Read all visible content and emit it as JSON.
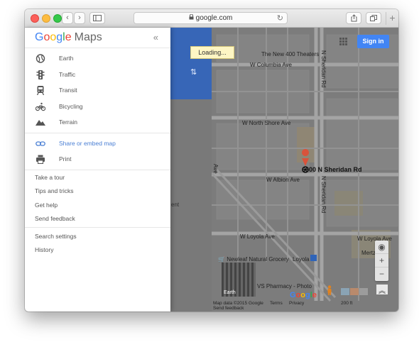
{
  "browser": {
    "url": "google.com",
    "new_tab": "+"
  },
  "map": {
    "loading_text": "Loading...",
    "sign_in": "Sign in",
    "address": "6600 N Sheridan Rd",
    "streets": {
      "columbia": "W Columbia Ave",
      "north_shore": "W North Shore Ave",
      "albion": "W Albion Ave",
      "loyola": "W Loyola Ave",
      "loyola2": "W Loyola Ave",
      "sheridan1": "N Sheridan Rd",
      "sheridan2": "N Sheridan Rd",
      "ave_fragment": "Ave"
    },
    "pois": {
      "theaters": "The New 400 Theaters",
      "grocery": "Newleaf Natural Grocery",
      "loyola_station": "Loyola",
      "pharmacy": "VS Pharmacy - Photo",
      "mertz": "Mertz"
    },
    "earth_label": "Earth",
    "google_logo": "Google",
    "attribution": {
      "data": "Map data ©2015 Google",
      "terms": "Terms",
      "privacy": "Privacy",
      "feedback": "Send feedback",
      "scale": "200 ft"
    },
    "panel_fragment": "ent"
  },
  "menu": {
    "logo_google": [
      "G",
      "o",
      "o",
      "g",
      "l",
      "e"
    ],
    "logo_maps": "Maps",
    "collapse": "«",
    "layers": [
      {
        "label": "Earth",
        "icon": "globe-icon"
      },
      {
        "label": "Traffic",
        "icon": "traffic-light-icon"
      },
      {
        "label": "Transit",
        "icon": "train-icon"
      },
      {
        "label": "Bicycling",
        "icon": "bicycle-icon"
      },
      {
        "label": "Terrain",
        "icon": "mountain-icon"
      }
    ],
    "share": {
      "label": "Share or embed map",
      "icon": "link-icon"
    },
    "print": {
      "label": "Print",
      "icon": "printer-icon"
    },
    "help": [
      "Take a tour",
      "Tips and tricks",
      "Get help",
      "Send feedback"
    ],
    "settings": [
      "Search settings",
      "History"
    ]
  },
  "colors": {
    "accent_blue": "#4285f4",
    "map_grey": "#7b7b7b",
    "pin_red": "#d9533b"
  }
}
